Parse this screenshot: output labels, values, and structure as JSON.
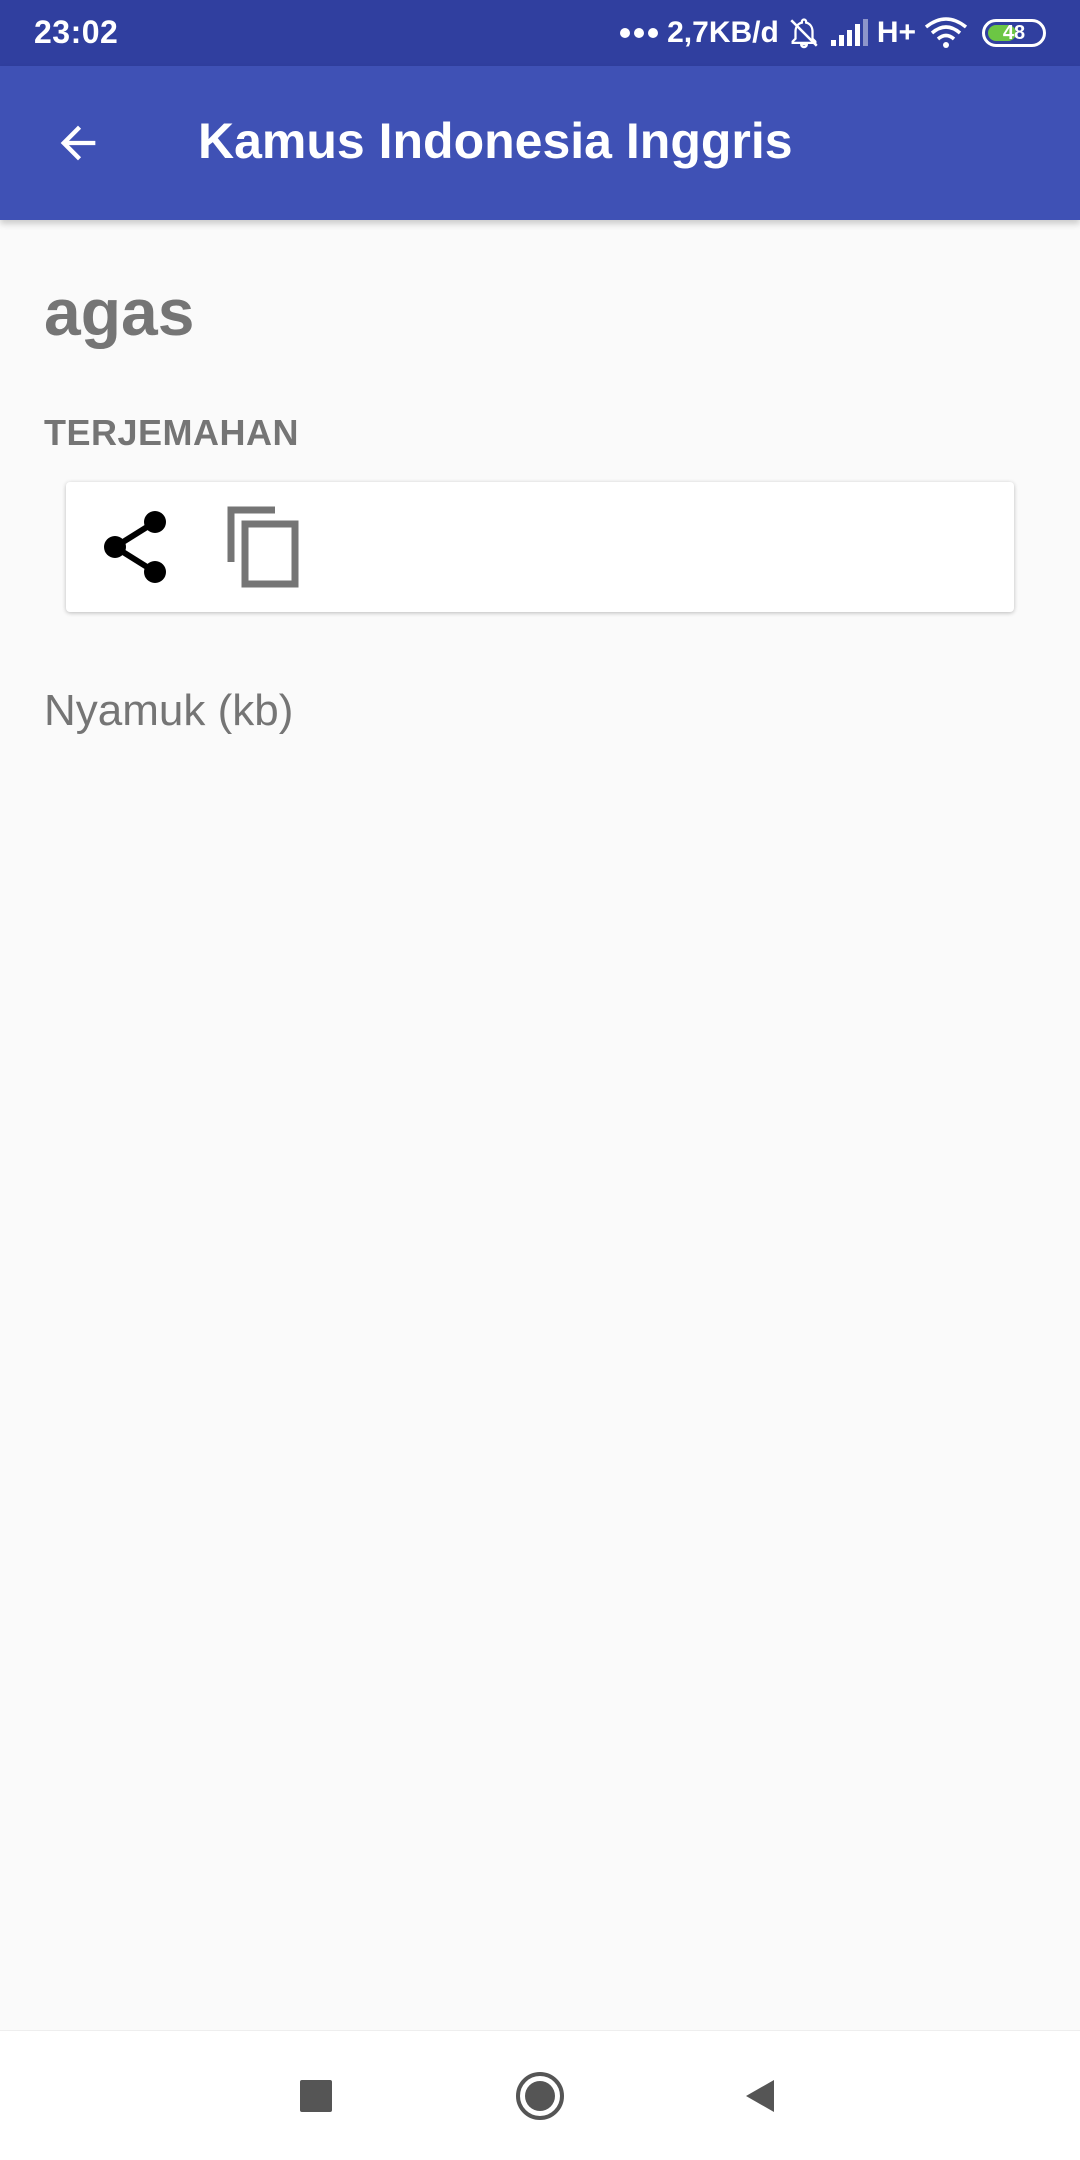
{
  "status_bar": {
    "time": "23:02",
    "network_speed": "2,7KB/d",
    "signal_type": "H+",
    "battery_level": "48",
    "icons": [
      "more-dots-icon",
      "bell-off-icon",
      "signal-icon",
      "wifi-icon",
      "battery-icon"
    ]
  },
  "app_bar": {
    "title": "Kamus Indonesia Inggris",
    "back_icon": "arrow-back-icon",
    "color": "#3f51b5",
    "status_color": "#303f9f"
  },
  "entry": {
    "word": "agas",
    "section_label": "TERJEMAHAN",
    "translation": "Nyamuk (kb)",
    "actions": [
      {
        "icon": "share-icon"
      },
      {
        "icon": "copy-icon"
      }
    ]
  },
  "nav_bar": {
    "icons": [
      "recents-square-icon",
      "home-circle-icon",
      "back-triangle-icon"
    ]
  }
}
